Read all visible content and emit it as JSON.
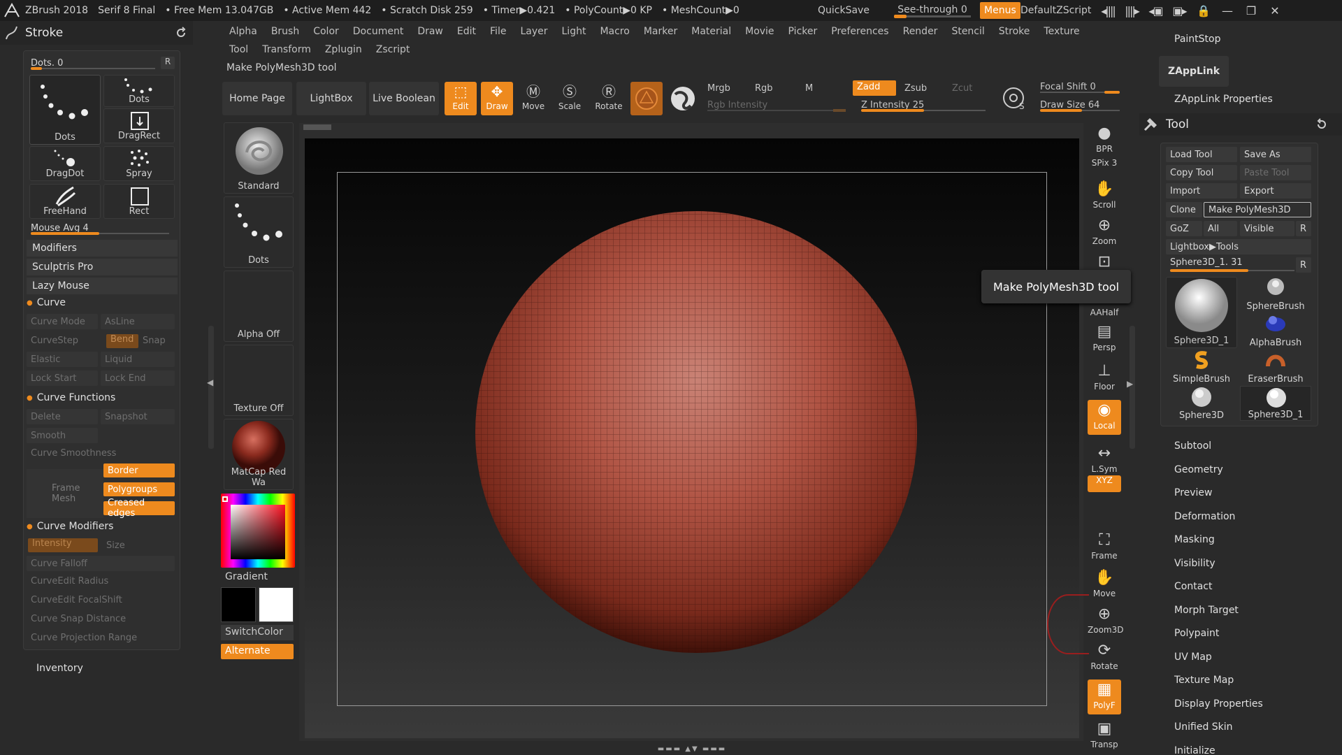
{
  "titlebar": {
    "app": "ZBrush 2018",
    "doc": "Serif 8 Final",
    "free_mem": "• Free Mem 13.047GB",
    "active_mem": "• Active Mem 442",
    "scratch": "• Scratch Disk 259",
    "timer": "• Timer▶0.421",
    "polycount": "• PolyCount▶0 KP",
    "meshcount": "• MeshCount▶0",
    "quicksave": "QuickSave",
    "see_through": "See-through  0",
    "see_through_value": 0,
    "menus": "Menus",
    "script": "DefaultZScript"
  },
  "menu_row1": [
    "Alpha",
    "Brush",
    "Color",
    "Document",
    "Draw",
    "Edit",
    "File",
    "Layer",
    "Light",
    "Macro",
    "Marker",
    "Material",
    "Movie",
    "Picker",
    "Preferences",
    "Render",
    "Stencil",
    "Stroke",
    "Texture"
  ],
  "menu_row2": [
    "Tool",
    "Transform",
    "Zplugin",
    "Zscript"
  ],
  "status_hint": "Make PolyMesh3D tool",
  "stroke": {
    "title": "Stroke",
    "dots_slider": "Dots. 0",
    "dots_value": 0,
    "r": "R",
    "tiles": [
      "Dots",
      "Dots",
      "DragRect",
      "DragDot",
      "Spray",
      "FreeHand",
      "Rect"
    ],
    "mouse_avg": "Mouse Avg 4",
    "mouse_avg_value": 4,
    "modifiers": "Modifiers",
    "sculptris": "Sculptris Pro",
    "lazy_mouse": "Lazy Mouse",
    "curve": "Curve",
    "curve_mode": "Curve Mode",
    "asline": "AsLine",
    "curvestep": "CurveStep",
    "bend": "Bend",
    "snap": "Snap",
    "elastic": "Elastic",
    "liquid": "Liquid",
    "lock_start": "Lock Start",
    "lock_end": "Lock End",
    "curve_functions": "Curve Functions",
    "delete": "Delete",
    "snapshot": "Snapshot",
    "smooth": "Smooth",
    "curve_smoothness": "Curve Smoothness",
    "border": "Border",
    "frame_mesh": "Frame Mesh",
    "polygroups": "Polygroups",
    "creased": "Creased edges",
    "curve_modifiers": "Curve Modifiers",
    "intensity": "Intensity",
    "size": "Size",
    "curve_falloff": "Curve Falloff",
    "curveedit_radius": "CurveEdit Radius",
    "curveedit_focal": "CurveEdit FocalShift",
    "curve_snap": "Curve Snap Distance",
    "curve_projection": "Curve Projection Range"
  },
  "inventory": "Inventory",
  "palette": {
    "standard": "Standard",
    "dots": "Dots",
    "alpha_off": "Alpha Off",
    "texture_off": "Texture Off",
    "matcap": "MatCap Red Wa",
    "gradient": "Gradient",
    "switchcolor": "SwitchColor",
    "alternate": "Alternate"
  },
  "toolbar": {
    "home_page": "Home Page",
    "lightbox": "LightBox",
    "live_boolean": "Live Boolean",
    "edit": "Edit",
    "draw": "Draw",
    "move": "Move",
    "scale": "Scale",
    "rotate": "Rotate",
    "mrgb": "Mrgb",
    "rgb": "Rgb",
    "m": "M",
    "rgb_intensity": "Rgb Intensity",
    "zadd": "Zadd",
    "zsub": "Zsub",
    "zcut": "Zcut",
    "z_intensity": "Z Intensity 25",
    "z_intensity_value": 25,
    "focal_shift": "Focal Shift 0",
    "focal_shift_value": 0,
    "draw_size": "Draw Size 64",
    "draw_size_value": 64
  },
  "shelf": [
    "BPR",
    "SPix 3",
    "Scroll",
    "Zoom",
    "Actual",
    "AAHalf",
    "Persp",
    "Floor",
    "Local",
    "L.Sym",
    "XYZ",
    "Frame",
    "Move",
    "Zoom3D",
    "Rotate",
    "PolyF",
    "Transp"
  ],
  "tooltip": "Make PolyMesh3D tool",
  "right": {
    "paintstop": "PaintStop",
    "zapplink": "ZAppLink",
    "zapplink_props": "ZAppLink Properties",
    "tool": "Tool",
    "load_tool": "Load Tool",
    "save_as": "Save As",
    "copy_tool": "Copy Tool",
    "paste_tool": "Paste Tool",
    "import": "Import",
    "export": "Export",
    "clone": "Clone",
    "make_polymesh": "Make PolyMesh3D",
    "goz": "GoZ",
    "all": "All",
    "visible": "Visible",
    "r": "R",
    "lightbox_tools": "Lightbox▶Tools",
    "sphere_slider": "Sphere3D_1. 31",
    "sphere_value": 31,
    "tools": [
      "Sphere3D_1",
      "SphereBrush",
      "AlphaBrush",
      "SimpleBrush",
      "EraserBrush",
      "Sphere3D",
      "Sphere3D_1"
    ],
    "sections": [
      "Subtool",
      "Geometry",
      "Preview",
      "Deformation",
      "Masking",
      "Visibility",
      "Contact",
      "Morph Target",
      "Polypaint",
      "UV Map",
      "Texture Map",
      "Display Properties",
      "Unified Skin",
      "Initialize"
    ]
  },
  "colors": {
    "accent": "#ee8a1e",
    "sphere": "#b4574a"
  }
}
